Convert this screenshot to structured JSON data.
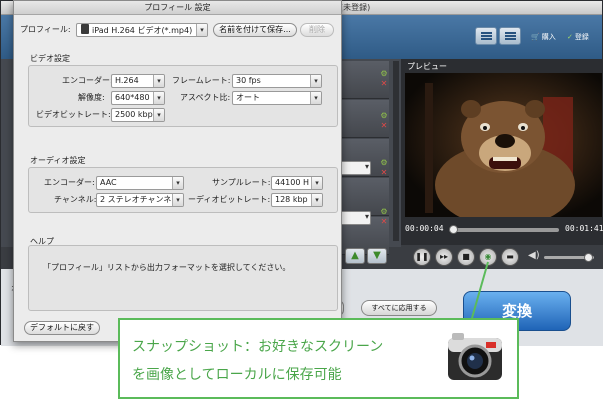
{
  "main_window": {
    "title": "Any MP4 iPad 変換 for Mac (未登録)",
    "toolbar": {
      "buy_label": "購入",
      "register_label": "登録"
    },
    "preview": {
      "title": "プレビュー",
      "time_current": "00:00:04",
      "time_total": "00:01:41",
      "seek_progress": 0.04,
      "volume_level": 0.88
    },
    "bottom": {
      "apply_all_label": "すべてに応用する",
      "output_label": "オ",
      "convert_label": "変換"
    }
  },
  "dialog": {
    "title": "プロフィール 設定",
    "profile_label": "プロフィール:",
    "profile_value": "iPad H.264 ビデオ(*.mp4)",
    "save_as_label": "名前を付けて保存...",
    "delete_label": "削除",
    "video_section": {
      "title": "ビデオ設定",
      "encoder_label": "エンコーダー:",
      "encoder_value": "H.264",
      "framerate_label": "フレームレート:",
      "framerate_value": "30 fps",
      "resolution_label": "解像度:",
      "resolution_value": "640*480",
      "aspect_label": "アスペクト比:",
      "aspect_value": "オート",
      "bitrate_label": "ビデオビットレート:",
      "bitrate_value": "2500 kbps"
    },
    "audio_section": {
      "title": "オーディオ設定",
      "encoder_label": "エンコーダー:",
      "encoder_value": "AAC",
      "samplerate_label": "サンプルレート:",
      "samplerate_value": "44100 H",
      "channel_label": "チャンネル:",
      "channel_value": "2 ステレオチャンネル",
      "bitrate_label": "ーディオビットレート:",
      "bitrate_value": "128 kbp"
    },
    "help_section": {
      "title": "ヘルプ",
      "text": "「プロフィール」リストから出力フォーマットを選択してください。"
    },
    "reset_label": "デフォルトに戻す"
  },
  "callout": {
    "line1": "スナップショット：お好きなスクリーン",
    "line2": "を画像としてローカルに保存可能"
  },
  "colors": {
    "accent_green": "#5bbb5a",
    "toolbar_blue": "#2f5b86",
    "convert_blue": "#1f64b7"
  }
}
